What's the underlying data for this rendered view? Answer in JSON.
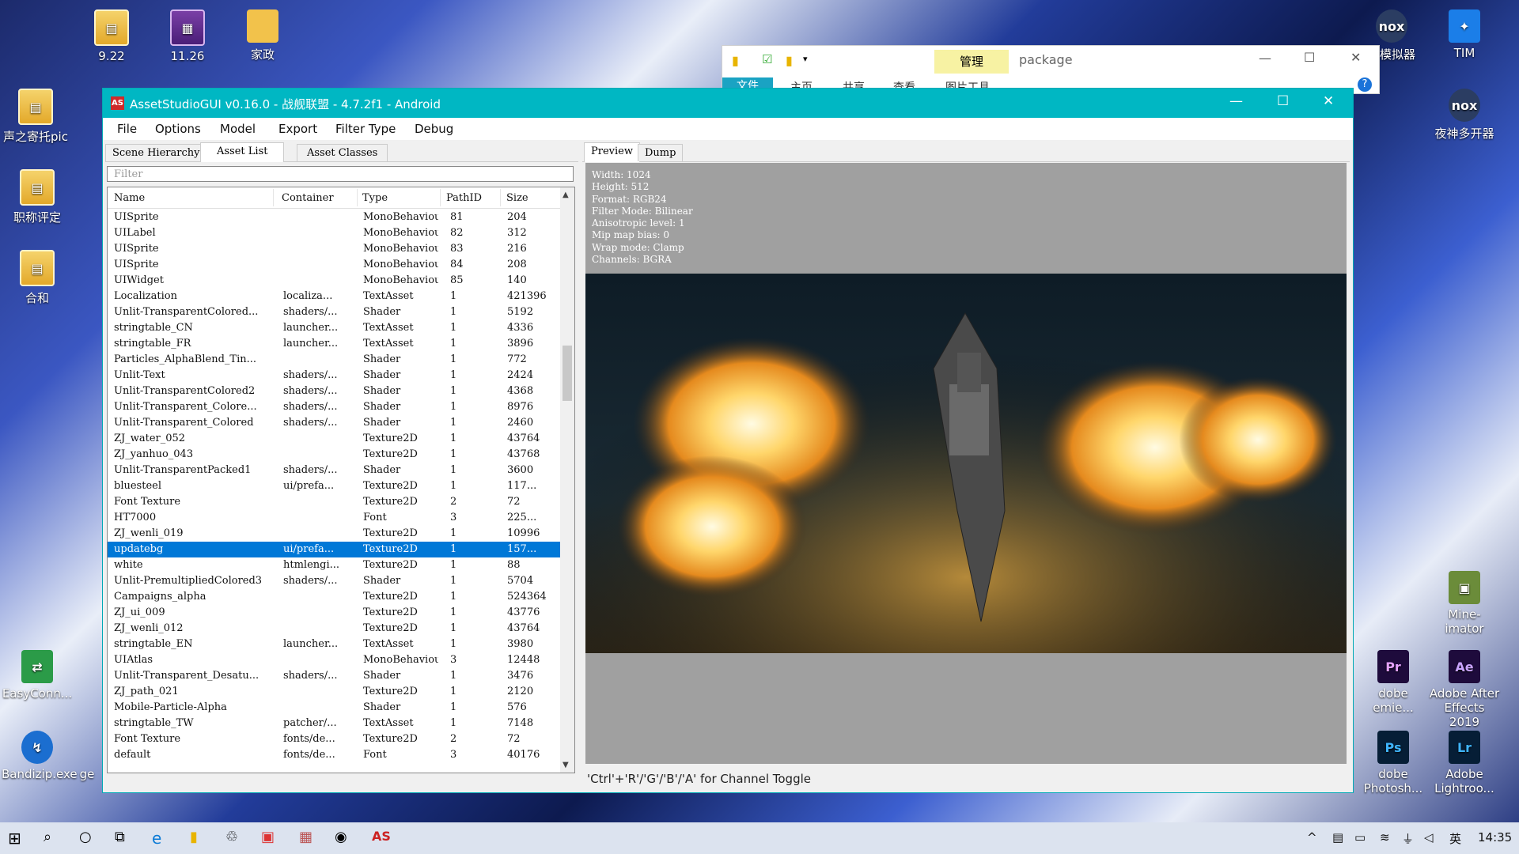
{
  "desktop": {
    "icons": [
      {
        "label": "9.22",
        "icon": "document-icon"
      },
      {
        "label": "11.26",
        "icon": "rar-archive-icon"
      },
      {
        "label": "家政",
        "icon": "folder-icon"
      },
      {
        "label": "声之寄托pic",
        "icon": "document-icon"
      },
      {
        "label": "职称评定",
        "icon": "document-icon"
      },
      {
        "label": "合和",
        "icon": "document-icon"
      },
      {
        "label": "EasyConn...",
        "icon": "easyconnect-icon"
      },
      {
        "label": "Bandizip.exe",
        "icon": "bandizip-icon"
      },
      {
        "label": "ge",
        "icon": "app-icon"
      },
      {
        "label": "神模拟器",
        "icon": "nox-emulator-icon"
      },
      {
        "label": "TIM",
        "icon": "tim-icon"
      },
      {
        "label": "夜神多开器",
        "icon": "nox-multi-icon"
      },
      {
        "label": "Mine-imator",
        "icon": "mine-imator-icon"
      },
      {
        "label": "dobe\nemie...",
        "icon": "premiere-icon"
      },
      {
        "label": "Adobe After\nEffects 2019",
        "icon": "after-effects-icon"
      },
      {
        "label": "dobe\nPhotosh...",
        "icon": "photoshop-icon"
      },
      {
        "label": "Adobe\nLightroo...",
        "icon": "lightroom-icon"
      }
    ]
  },
  "explorer": {
    "manage_label": "管理",
    "title": "package",
    "tabs": [
      "文件",
      "主页",
      "共享",
      "查看",
      "图片工具"
    ]
  },
  "app": {
    "title": "AssetStudioGUI v0.16.0 - 战舰联盟 - 4.7.2f1 - Android",
    "logo_text": "AS",
    "menu": [
      "File",
      "Options",
      "Model",
      "Export",
      "Filter Type",
      "Debug"
    ],
    "left_tabs": [
      "Scene Hierarchy",
      "Asset List",
      "Asset Classes"
    ],
    "filter_placeholder": "Filter",
    "columns": [
      "Name",
      "Container",
      "Type",
      "PathID",
      "Size"
    ],
    "rows": [
      [
        "UISprite",
        "",
        "MonoBehaviour",
        "81",
        "204"
      ],
      [
        "UILabel",
        "",
        "MonoBehaviour",
        "82",
        "312"
      ],
      [
        "UISprite",
        "",
        "MonoBehaviour",
        "83",
        "216"
      ],
      [
        "UISprite",
        "",
        "MonoBehaviour",
        "84",
        "208"
      ],
      [
        "UIWidget",
        "",
        "MonoBehaviour",
        "85",
        "140"
      ],
      [
        "Localization",
        "localiza...",
        "TextAsset",
        "1",
        "421396"
      ],
      [
        "Unlit-TransparentColored...",
        "shaders/...",
        "Shader",
        "1",
        "5192"
      ],
      [
        "stringtable_CN",
        "launcher...",
        "TextAsset",
        "1",
        "4336"
      ],
      [
        "stringtable_FR",
        "launcher...",
        "TextAsset",
        "1",
        "3896"
      ],
      [
        "Particles_AlphaBlend_Tin...",
        "",
        "Shader",
        "1",
        "772"
      ],
      [
        "Unlit-Text",
        "shaders/...",
        "Shader",
        "1",
        "2424"
      ],
      [
        "Unlit-TransparentColored2",
        "shaders/...",
        "Shader",
        "1",
        "4368"
      ],
      [
        "Unlit-Transparent_Colore...",
        "shaders/...",
        "Shader",
        "1",
        "8976"
      ],
      [
        "Unlit-Transparent_Colored",
        "shaders/...",
        "Shader",
        "1",
        "2460"
      ],
      [
        "ZJ_water_052",
        "",
        "Texture2D",
        "1",
        "43764"
      ],
      [
        "ZJ_yanhuo_043",
        "",
        "Texture2D",
        "1",
        "43768"
      ],
      [
        "Unlit-TransparentPacked1",
        "shaders/...",
        "Shader",
        "1",
        "3600"
      ],
      [
        "bluesteel",
        "ui/prefa...",
        "Texture2D",
        "1",
        "117..."
      ],
      [
        "Font Texture",
        "",
        "Texture2D",
        "2",
        "72"
      ],
      [
        "HT7000",
        "",
        "Font",
        "3",
        "225..."
      ],
      [
        "ZJ_wenli_019",
        "",
        "Texture2D",
        "1",
        "10996"
      ],
      [
        "updatebg",
        "ui/prefa...",
        "Texture2D",
        "1",
        "157..."
      ],
      [
        "white",
        "htmlengi...",
        "Texture2D",
        "1",
        "88"
      ],
      [
        "Unlit-PremultipliedColored3",
        "shaders/...",
        "Shader",
        "1",
        "5704"
      ],
      [
        "Campaigns_alpha",
        "",
        "Texture2D",
        "1",
        "524364"
      ],
      [
        "ZJ_ui_009",
        "",
        "Texture2D",
        "1",
        "43776"
      ],
      [
        "ZJ_wenli_012",
        "",
        "Texture2D",
        "1",
        "43764"
      ],
      [
        "stringtable_EN",
        "launcher...",
        "TextAsset",
        "1",
        "3980"
      ],
      [
        "UIAtlas",
        "",
        "MonoBehaviour",
        "3",
        "12448"
      ],
      [
        "Unlit-Transparent_Desatu...",
        "shaders/...",
        "Shader",
        "1",
        "3476"
      ],
      [
        "ZJ_path_021",
        "",
        "Texture2D",
        "1",
        "2120"
      ],
      [
        "Mobile-Particle-Alpha",
        "",
        "Shader",
        "1",
        "576"
      ],
      [
        "stringtable_TW",
        "patcher/...",
        "TextAsset",
        "1",
        "7148"
      ],
      [
        "Font Texture",
        "fonts/de...",
        "Texture2D",
        "2",
        "72"
      ],
      [
        "default",
        "fonts/de...",
        "Font",
        "3",
        "40176"
      ]
    ],
    "selected_row": 21,
    "right_tabs": [
      "Preview",
      "Dump"
    ],
    "texture_info": "Width: 1024\nHeight: 512\nFormat: RGB24\nFilter Mode: Bilinear\nAnisotropic level: 1\nMip map bias: 0\nWrap mode: Clamp\nChannels: BGRA",
    "status": "'Ctrl'+'R'/'G'/'B'/'A' for Channel Toggle",
    "progress_fraction": 1.0
  },
  "taskbar": {
    "tray": [
      "^",
      "英",
      "14:35"
    ]
  }
}
